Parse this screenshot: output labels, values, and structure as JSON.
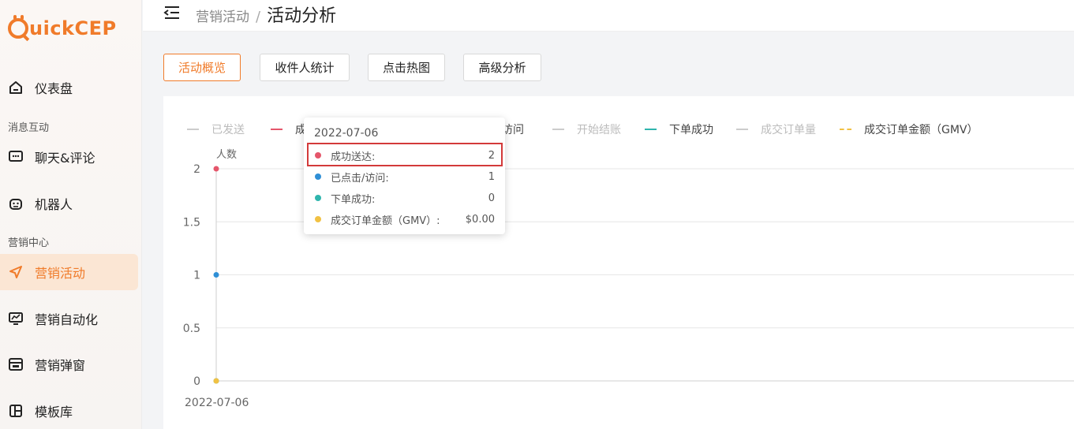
{
  "app": {
    "logo_text": "uickCEP"
  },
  "header": {
    "breadcrumb_parent": "营销活动",
    "breadcrumb_sep": "/",
    "breadcrumb_current": "活动分析"
  },
  "sidebar": {
    "items": [
      {
        "label": "仪表盘",
        "icon": "home-icon"
      },
      {
        "label": "聊天&评论",
        "icon": "chat-icon"
      },
      {
        "label": "机器人",
        "icon": "robot-icon"
      },
      {
        "label": "营销活动",
        "icon": "send-icon",
        "active": true
      },
      {
        "label": "营销自动化",
        "icon": "monitor-chart-icon"
      },
      {
        "label": "营销弹窗",
        "icon": "popup-window-icon"
      },
      {
        "label": "模板库",
        "icon": "template-icon"
      }
    ],
    "sections": [
      "消息互动",
      "营销中心"
    ]
  },
  "tabs": [
    {
      "label": "活动概览",
      "active": true
    },
    {
      "label": "收件人统计"
    },
    {
      "label": "点击热图"
    },
    {
      "label": "高级分析"
    }
  ],
  "chart_data": {
    "type": "line",
    "ylabel": "人数",
    "ylim": [
      0,
      2
    ],
    "yticks": [
      "0",
      "0.5",
      "1",
      "1.5",
      "2"
    ],
    "categories": [
      "2022-07-06"
    ],
    "series": [
      {
        "name": "已发送",
        "values": [],
        "color": "#cccccc",
        "enabled": false
      },
      {
        "name": "成功送达",
        "values": [
          2
        ],
        "color": "#e5566b",
        "enabled": true
      },
      {
        "name": "已点击/访问",
        "values": [
          1
        ],
        "color": "#2f8fd6",
        "enabled": true
      },
      {
        "name": "开始结账",
        "values": [],
        "color": "#cccccc",
        "enabled": false
      },
      {
        "name": "下单成功",
        "values": [
          0
        ],
        "color": "#2fb5ad",
        "enabled": true
      },
      {
        "name": "成交订单量",
        "values": [],
        "color": "#cccccc",
        "enabled": false
      },
      {
        "name": "成交订单金额（GMV）",
        "values": [
          0
        ],
        "color": "#f1c143",
        "enabled": true,
        "dashed": true
      }
    ]
  },
  "legend_visible": {
    "sent": "已发送",
    "delivered_partial": "成",
    "visited_partial": "访问",
    "checkout": "开始结账",
    "order_ok": "下单成功",
    "orders": "成交订单量",
    "gmv": "成交订单金额（GMV）"
  },
  "tooltip": {
    "date": "2022-07-06",
    "rows": [
      {
        "label": "成功送达:",
        "value": "2",
        "color": "#e5566b"
      },
      {
        "label": "已点击/访问:",
        "value": "1",
        "color": "#2f8fd6"
      },
      {
        "label": "下单成功:",
        "value": "0",
        "color": "#2fb5ad"
      },
      {
        "label": "成交订单金额（GMV）:",
        "value": "$0.00",
        "color": "#f1c143"
      }
    ]
  }
}
